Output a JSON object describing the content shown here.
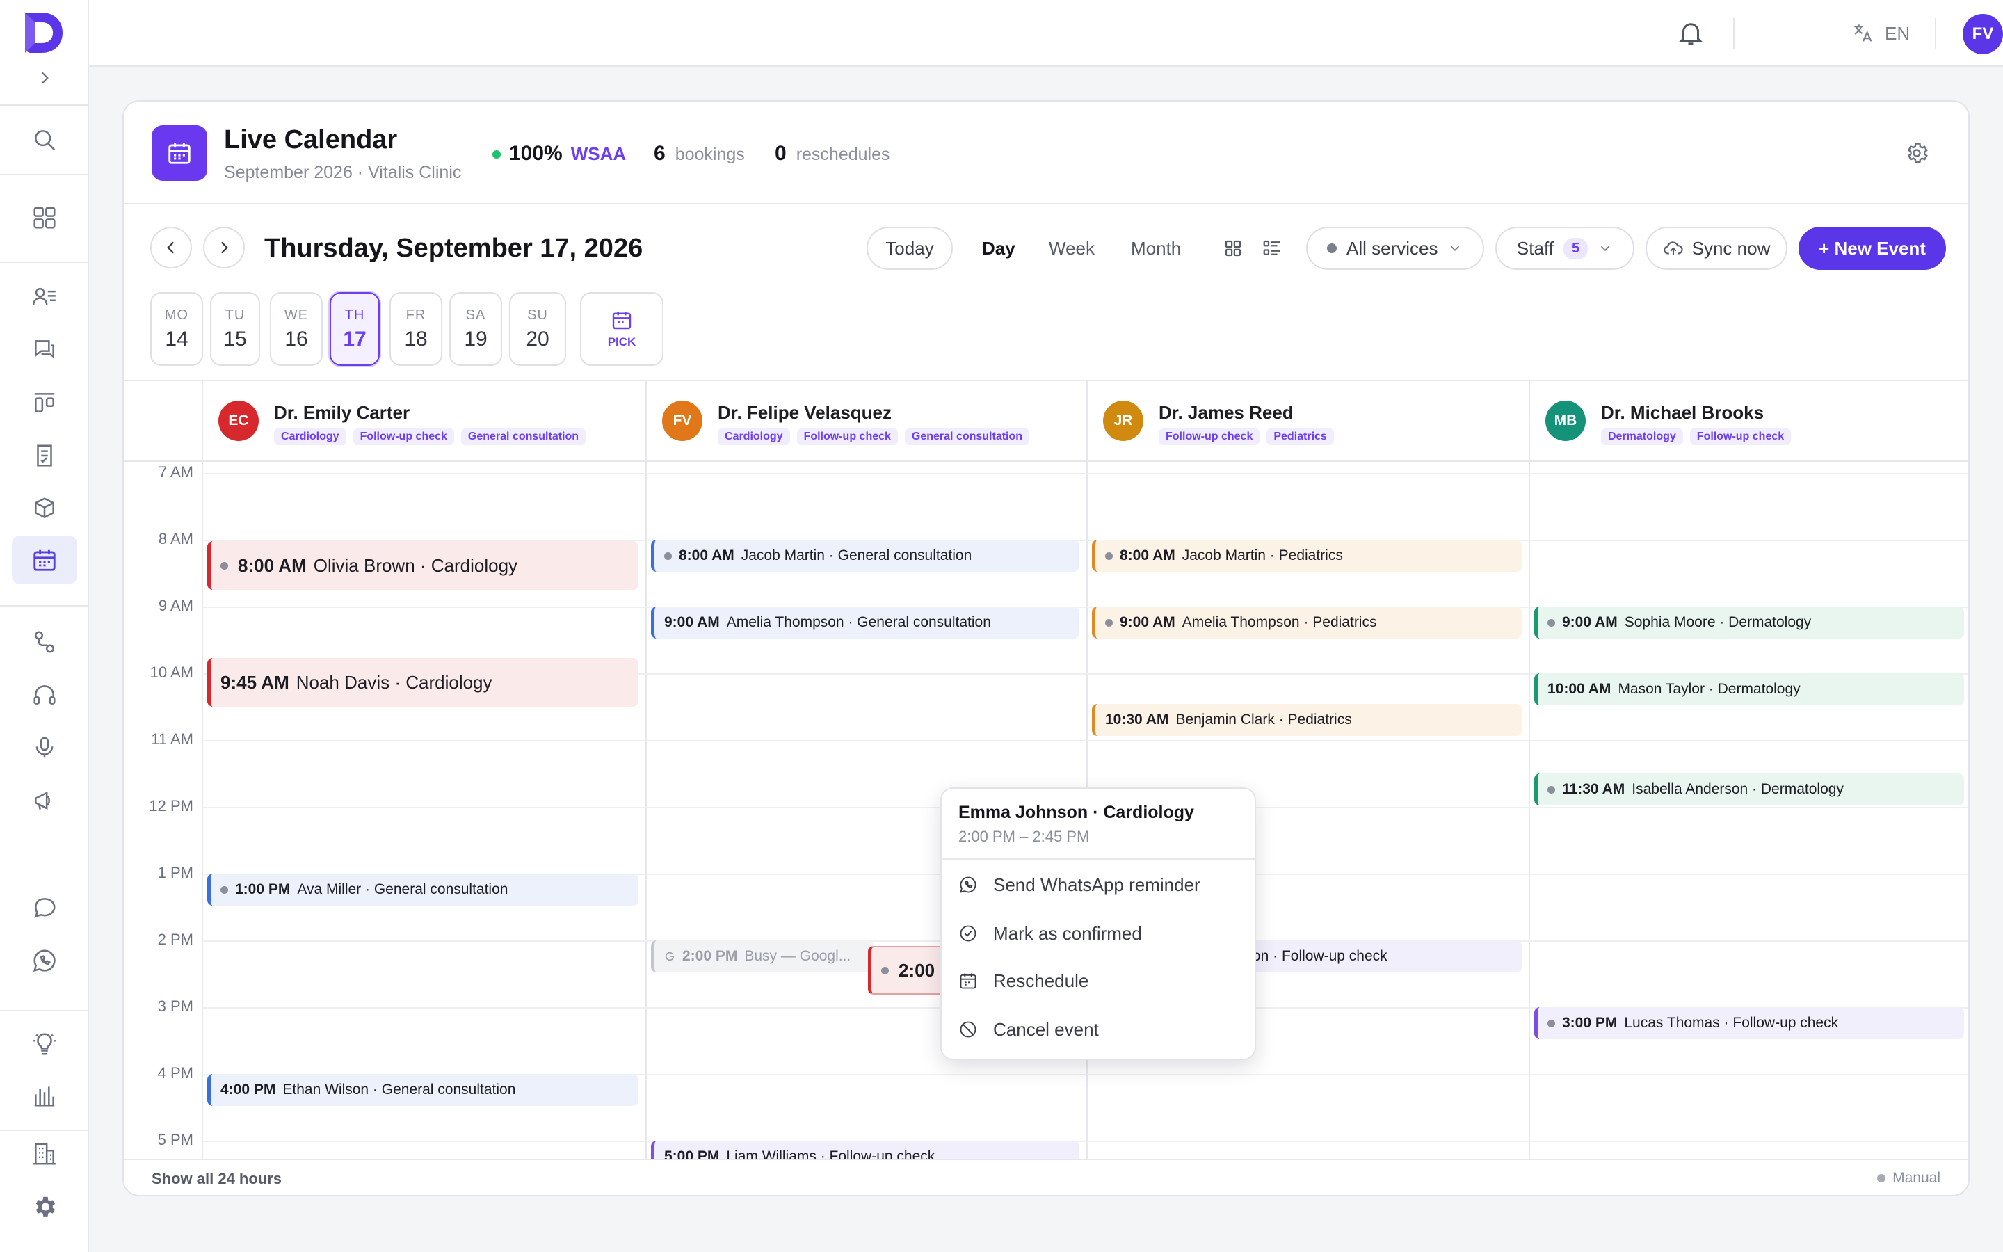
{
  "topbar": {
    "lang": "EN",
    "user_initials": "FV"
  },
  "header": {
    "title": "Live Calendar",
    "subtitle": "September 2026 · Vitalis Clinic",
    "wsaa_value": "100%",
    "wsaa_label": "WSAA",
    "bookings_count": "6",
    "bookings_label": "bookings",
    "reschedules_count": "0",
    "reschedules_label": "reschedules"
  },
  "toolbar": {
    "date_title": "Thursday, September 17, 2026",
    "today": "Today",
    "views": [
      "Day",
      "Week",
      "Month"
    ],
    "active_view": "Day",
    "services": "All services",
    "staff": "Staff",
    "staff_count": "5",
    "sync": "Sync now",
    "new_event": "+ New Event"
  },
  "days": [
    {
      "name": "MO",
      "num": "14"
    },
    {
      "name": "TU",
      "num": "15"
    },
    {
      "name": "WE",
      "num": "16"
    },
    {
      "name": "TH",
      "num": "17"
    },
    {
      "name": "FR",
      "num": "18"
    },
    {
      "name": "SA",
      "num": "19"
    },
    {
      "name": "SU",
      "num": "20"
    }
  ],
  "pick_label": "PICK",
  "times": [
    "7 AM",
    "8 AM",
    "9 AM",
    "10 AM",
    "11 AM",
    "12 PM",
    "1 PM",
    "2 PM",
    "3 PM",
    "4 PM",
    "5 PM"
  ],
  "staff": [
    {
      "initials": "EC",
      "name": "Dr. Emily Carter",
      "color": "#d6282d",
      "tags": [
        "Cardiology",
        "Follow-up check",
        "General consultation"
      ]
    },
    {
      "initials": "FV",
      "name": "Dr. Felipe Velasquez",
      "color": "#e0781a",
      "tags": [
        "Cardiology",
        "Follow-up check",
        "General consultation"
      ]
    },
    {
      "initials": "JR",
      "name": "Dr. James Reed",
      "color": "#d08a10",
      "tags": [
        "Follow-up check",
        "Pediatrics"
      ]
    },
    {
      "initials": "MB",
      "name": "Dr. Michael Brooks",
      "color": "#14937a",
      "tags": [
        "Dermatology",
        "Follow-up check"
      ]
    }
  ],
  "events": [
    {
      "col": 0,
      "time": "8:00 AM",
      "text": "Olivia Brown · Cardiology",
      "variant": "red",
      "big": true
    },
    {
      "col": 0,
      "time": "9:45 AM",
      "text": "Noah Davis · Cardiology",
      "variant": "red",
      "big": true,
      "nodot": true
    },
    {
      "col": 0,
      "time": "1:00 PM",
      "text": "Ava Miller · General consultation",
      "variant": "blue"
    },
    {
      "col": 0,
      "time": "4:00 PM",
      "text": "Ethan Wilson · General consultation",
      "variant": "blue",
      "nodot": true
    },
    {
      "col": 1,
      "time": "8:00 AM",
      "text": "Jacob Martin · General consultation",
      "variant": "blue"
    },
    {
      "col": 1,
      "time": "9:00 AM",
      "text": "Amelia Thompson · General consultation",
      "variant": "blue",
      "nodot": true
    },
    {
      "col": 1,
      "time": "2:00 PM",
      "text": "Busy — Googl...",
      "variant": "gray",
      "google": true
    },
    {
      "col": 1,
      "time": "2:00 PM",
      "text": "Emma J...",
      "variant": "sel",
      "big": true,
      "warn": true
    },
    {
      "col": 1,
      "time": "5:00 PM",
      "text": "Liam Williams · Follow-up check",
      "variant": "purple",
      "nodot": true
    },
    {
      "col": 2,
      "time": "8:00 AM",
      "text": "Jacob Martin · Pediatrics",
      "variant": "orange"
    },
    {
      "col": 2,
      "time": "9:00 AM",
      "text": "Amelia Thompson · Pediatrics",
      "variant": "orange"
    },
    {
      "col": 2,
      "time": "10:30 AM",
      "text": "Benjamin Clark · Pediatrics",
      "variant": "orange",
      "nodot": true
    },
    {
      "col": 2,
      "time": "2:00 PM",
      "text": "Emma Johnson · Follow-up check",
      "variant": "purple",
      "nodot": true
    },
    {
      "col": 3,
      "time": "9:00 AM",
      "text": "Sophia Moore · Dermatology",
      "variant": "green"
    },
    {
      "col": 3,
      "time": "10:00 AM",
      "text": "Mason Taylor · Dermatology",
      "variant": "green",
      "nodot": true
    },
    {
      "col": 3,
      "time": "11:30 AM",
      "text": "Isabella Anderson · Dermatology",
      "variant": "green"
    },
    {
      "col": 3,
      "time": "3:00 PM",
      "text": "Lucas Thomas · Follow-up check",
      "variant": "purple"
    }
  ],
  "popover": {
    "title": "Emma Johnson · Cardiology",
    "time": "2:00 PM – 2:45 PM",
    "items": [
      {
        "label": "Send WhatsApp reminder",
        "icon": "whatsapp-icon"
      },
      {
        "label": "Mark as confirmed",
        "icon": "check-circle-icon"
      },
      {
        "label": "Reschedule",
        "icon": "calendar-icon"
      },
      {
        "label": "Cancel event",
        "icon": "cancel-icon"
      }
    ]
  },
  "footer": {
    "show_all": "Show all 24 hours",
    "sync_mode": "Manual"
  },
  "colors": {
    "accent": "#5b35e8",
    "success": "#1fc16b"
  }
}
